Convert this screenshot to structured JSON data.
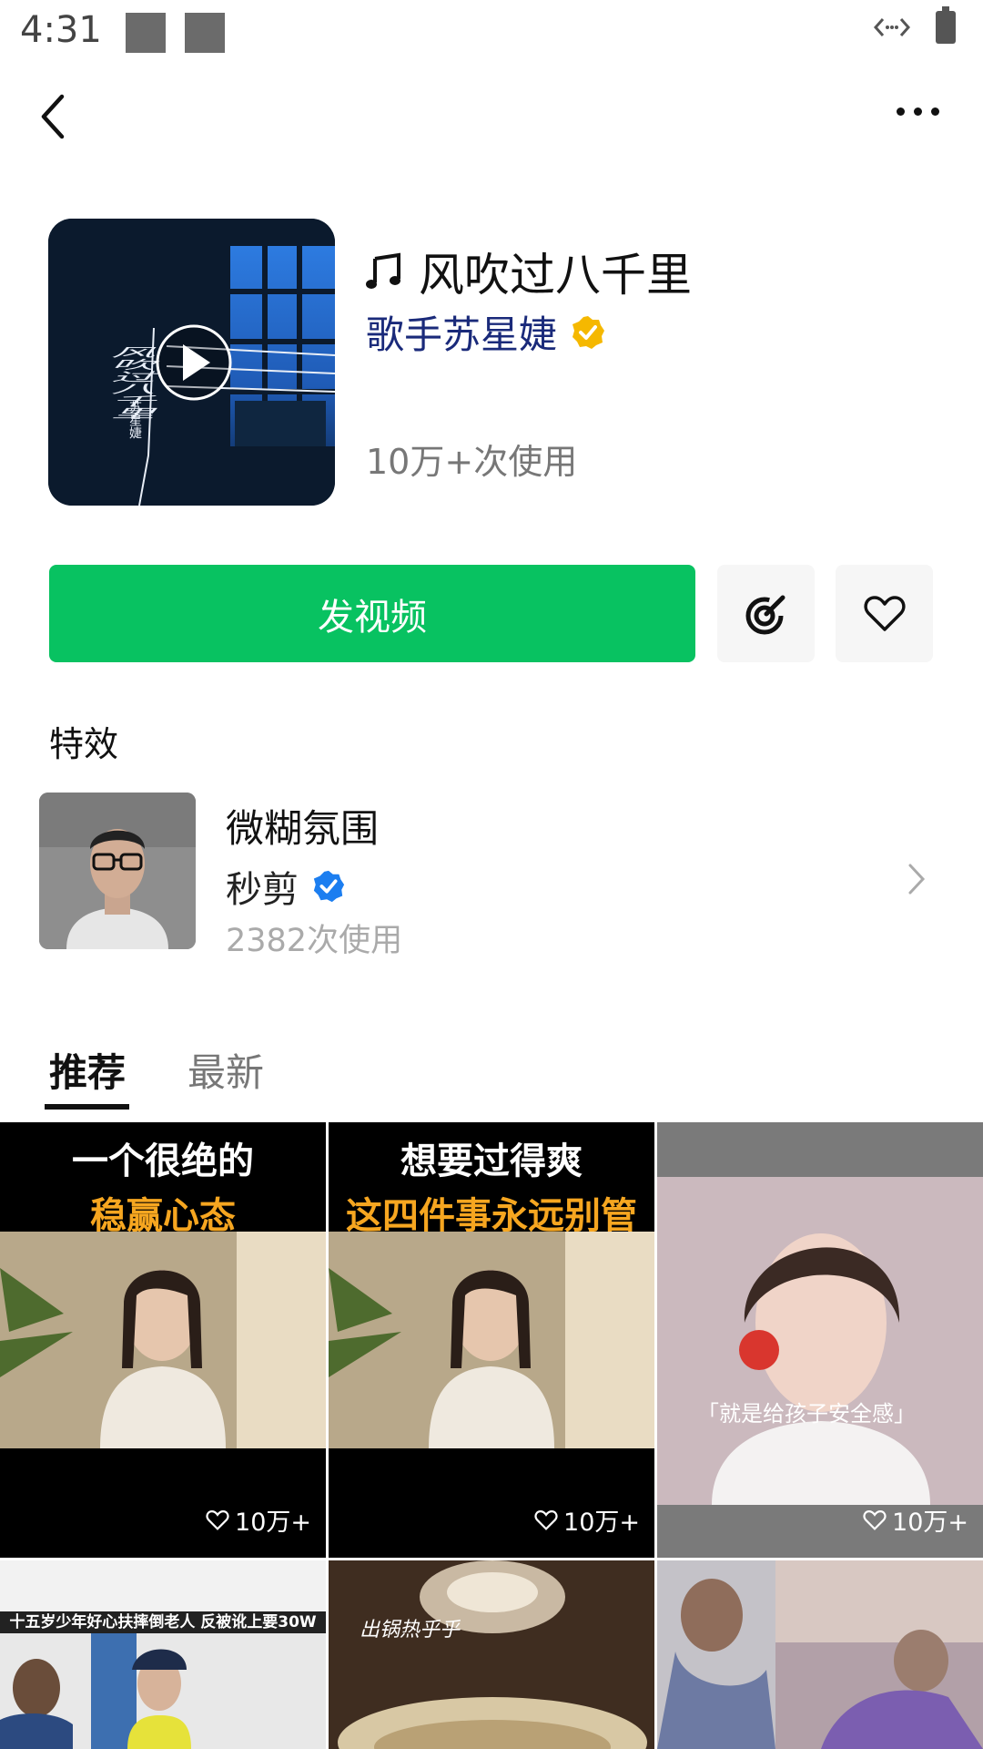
{
  "status_bar": {
    "time": "4:31"
  },
  "song": {
    "title": "风吹过八千里",
    "singer": "歌手苏星婕",
    "uses": "10万+次使用",
    "cover_art_text": {
      "title": "风吹过八千里",
      "artist": "苏星婕"
    }
  },
  "actions": {
    "post_video_label": "发视频",
    "colors": {
      "primary": "#08c261",
      "verified_gold": "#f5b800",
      "verified_blue": "#1c7ef0",
      "singer": "#1a2a7a"
    }
  },
  "effects_section": {
    "title": "特效",
    "item": {
      "name": "微糊氛围",
      "author": "秒剪",
      "uses": "2382次使用"
    }
  },
  "tabs": [
    {
      "label": "推荐",
      "active": true
    },
    {
      "label": "最新",
      "active": false
    }
  ],
  "videos": [
    {
      "line1": "一个很绝的",
      "line2": "稳赢心态",
      "likes": "10万+"
    },
    {
      "line1": "想要过得爽",
      "line2": "这四件事永远别管",
      "likes": "10万+"
    },
    {
      "subtitle": "「就是给孩子安全感」",
      "likes": "10万+"
    },
    {
      "caption": "十五岁少年好心扶摔倒老人 反被讹上要30W"
    },
    {
      "caption": "出锅热乎乎"
    },
    {}
  ]
}
